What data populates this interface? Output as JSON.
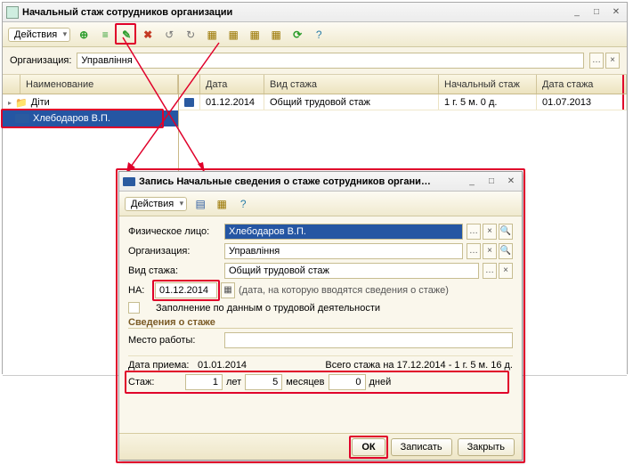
{
  "main": {
    "title": "Начальный стаж сотрудников организации",
    "actions_label": "Действия",
    "org_label": "Организация:",
    "org_value": "Управління"
  },
  "tree": {
    "header": "Наименование",
    "items": [
      {
        "label": "Діти"
      },
      {
        "label": "Хлебодаров В.П."
      }
    ]
  },
  "grid": {
    "cols": {
      "date": "Дата",
      "type": "Вид стажа",
      "start": "Начальный стаж",
      "stazh_date": "Дата стажа"
    },
    "row": {
      "date": "01.12.2014",
      "type": "Общий трудовой стаж",
      "start": "1 г. 5 м. 0 д.",
      "stazh_date": "01.07.2013"
    }
  },
  "dialog": {
    "title": "Запись Начальные сведения о стаже сотрудников органи…",
    "actions_label": "Действия",
    "phys_label": "Физическое лицо:",
    "phys_value": "Хлебодаров В.П.",
    "org_label": "Организация:",
    "org_value": "Управління",
    "type_label": "Вид стажа:",
    "type_value": "Общий трудовой стаж",
    "na_label": "НА:",
    "na_value": "01.12.2014",
    "na_hint": "(дата, на которую вводятся сведения о стаже)",
    "fill_label": "Заполнение по данным о трудовой деятельности",
    "section_title": "Сведения о стаже",
    "workplace_label": "Место работы:",
    "workplace_value": "",
    "hired_label": "Дата приема:",
    "hired_value": "01.01.2014",
    "total_label": "Всего стажа на 17.12.2014 - 1 г. 5 м. 16 д.",
    "stazh_label": "Стаж:",
    "years_value": "1",
    "years_unit": "лет",
    "months_value": "5",
    "months_unit": "месяцев",
    "days_value": "0",
    "days_unit": "дней",
    "btn_ok": "ОК",
    "btn_save": "Записать",
    "btn_close": "Закрыть"
  }
}
